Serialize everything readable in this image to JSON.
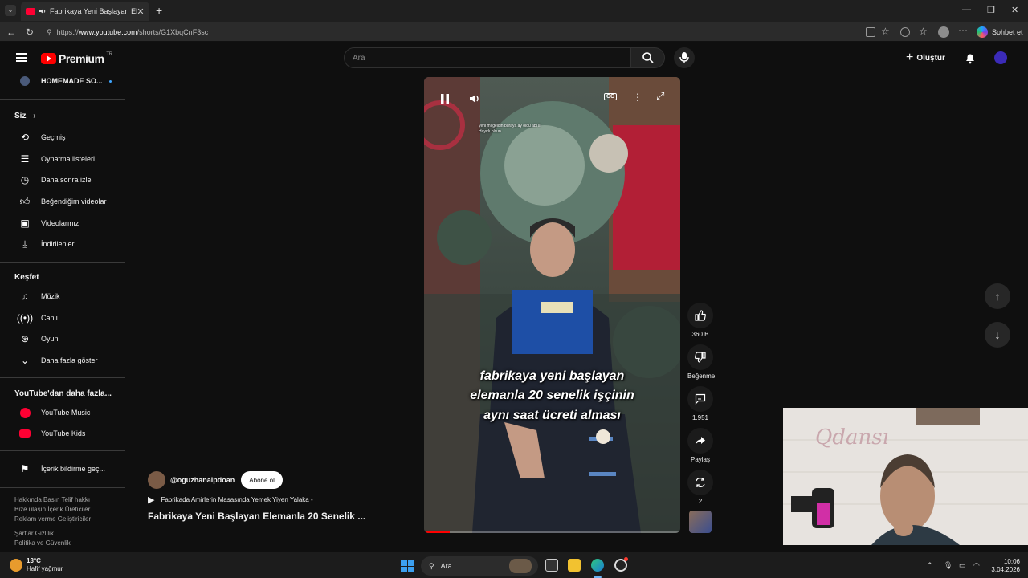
{
  "browser": {
    "tab_title": "Fabrikaya Yeni Başlayan Elem...",
    "url_prefix": "https://",
    "url_host": "www.youtube.com",
    "url_path": "/shorts/G1XbqCnF3sc",
    "chat_label": "Sohbet et"
  },
  "masthead": {
    "brand": "Premium",
    "region": "TR",
    "search_placeholder": "Ara",
    "create_label": "Oluştur"
  },
  "sidebar": {
    "account_label": "HOMEMADE SO...",
    "you_header": "Siz",
    "you_items": [
      {
        "label": "Geçmiş",
        "icon": "history-icon"
      },
      {
        "label": "Oynatma listeleri",
        "icon": "playlists-icon"
      },
      {
        "label": "Daha sonra izle",
        "icon": "clock-icon"
      },
      {
        "label": "Beğendiğim videolar",
        "icon": "thumb-up-icon"
      },
      {
        "label": "Videolarınız",
        "icon": "your-videos-icon"
      },
      {
        "label": "İndirilenler",
        "icon": "download-icon"
      }
    ],
    "explore_header": "Keşfet",
    "explore_items": [
      {
        "label": "Müzik",
        "icon": "music-icon"
      },
      {
        "label": "Canlı",
        "icon": "live-icon"
      },
      {
        "label": "Oyun",
        "icon": "gaming-icon"
      },
      {
        "label": "Daha fazla göster",
        "icon": "chevron-down-icon"
      }
    ],
    "more_header": "YouTube'dan daha fazla...",
    "more_items": [
      {
        "label": "YouTube Music",
        "icon": "youtube-music-icon"
      },
      {
        "label": "YouTube Kids",
        "icon": "youtube-kids-icon"
      }
    ],
    "report_label": "İçerik bildirme geç...",
    "footer_line1": "Hakkında  Basın  Telif hakkı",
    "footer_line2": "Bize ulaşın  İçerik Üreticiler",
    "footer_line3": "Reklam verme  Geliştiriciler",
    "footer_line4": "Şartlar  Gizlilik",
    "footer_line5": "Politika ve Güvenlik"
  },
  "video": {
    "caption_line1": "fabrikaya yeni başlayan",
    "caption_line2": "elemanla 20 senelik işçinin",
    "caption_line3": "aynı saat ücreti alması",
    "small_caption_line1": "yeni mi geldin buraya ay oldu abi il",
    "small_caption_line2": "Hayırlı olsun",
    "progress": 0.1
  },
  "actions": {
    "like_count": "360 B",
    "dislike_label": "Beğenme",
    "comment_count": "1.951",
    "share_label": "Paylaş",
    "remix_count": "2"
  },
  "channel": {
    "handle": "@oguzhanalpdoan",
    "subscribe_label": "Abone ol",
    "playlist_label": "Fabrikada Amirlerin Masasında Yemek Yiyen Yalaka -",
    "video_title": "Fabrikaya Yeni Başlayan Elemanla 20 Senelik ..."
  },
  "webcam": {
    "wall_sign": "Qdansı"
  },
  "taskbar": {
    "temperature": "13°C",
    "weather": "Hafif yağmur",
    "search_label": "Ara",
    "time": "10:06",
    "date": "3.04.2026"
  }
}
